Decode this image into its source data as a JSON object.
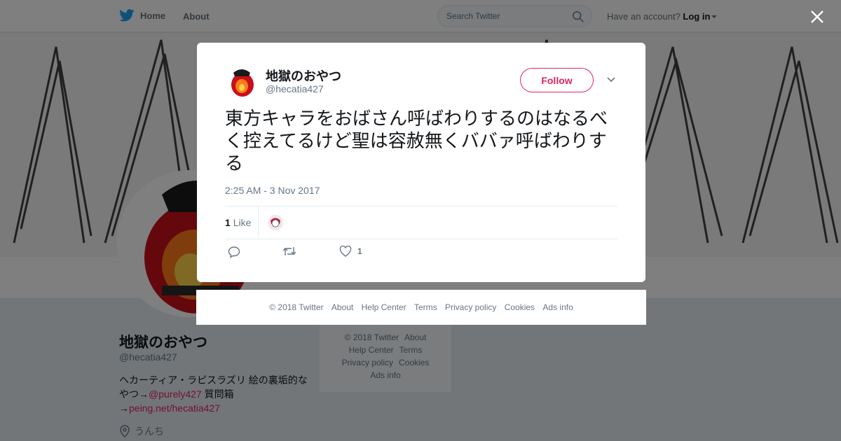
{
  "nav": {
    "home_label": "Home",
    "about_label": "About",
    "search_placeholder": "Search Twitter",
    "account_prompt": "Have an account?",
    "login_label": "Log in"
  },
  "profile": {
    "name": "地獄のおやつ",
    "handle": "@hecatia427",
    "bio_prefix": "ヘカーティア・ラピスラズリ 絵の裏垢的なやつ→",
    "bio_mention": "@purely427",
    "bio_middle": " 質問箱→",
    "bio_link": "peing.net/hecatia427",
    "location": "うんち"
  },
  "side_footer": {
    "copyright": "© 2018 Twitter",
    "about": "About",
    "help": "Help Center",
    "terms": "Terms",
    "privacy": "Privacy policy",
    "cookies": "Cookies",
    "ads": "Ads info"
  },
  "tweet": {
    "author_name": "地獄のおやつ",
    "author_handle": "@hecatia427",
    "follow_label": "Follow",
    "text": "東方キャラをおばさん呼ばわりするのはなるべく控えてるけど聖は容赦無くババァ呼ばわりする",
    "timestamp": "2:25 AM - 3 Nov 2017",
    "like_count": "1",
    "like_label": "Like",
    "heart_count": "1"
  },
  "modal_footer": {
    "copyright": "© 2018 Twitter",
    "about": "About",
    "help": "Help Center",
    "terms": "Terms",
    "privacy": "Privacy policy",
    "cookies": "Cookies",
    "ads": "Ads info"
  },
  "colors": {
    "twitter_blue": "#1da1f2",
    "accent": "#e0245e",
    "muted": "#657786"
  },
  "icons": [
    "twitter-bird-icon",
    "search-icon",
    "close-icon",
    "chevron-down-icon",
    "reply-icon",
    "retweet-icon",
    "heart-icon",
    "location-icon"
  ]
}
